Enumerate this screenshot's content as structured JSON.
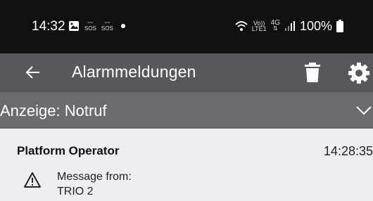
{
  "status_bar": {
    "time": "14:32",
    "sos_1": "SOS",
    "sos_2": "SOS",
    "volte_top": "Vo))",
    "volte_bottom": "LTE1",
    "network": "4G",
    "battery": "100%"
  },
  "app_bar": {
    "title": "Alarmmeldungen"
  },
  "filter": {
    "label": "Anzeige: Notruf"
  },
  "message": {
    "sender": "Platform Operator",
    "time": "14:28:35",
    "line1": "Message from:",
    "line2": "TRIO 2"
  },
  "colors": {
    "status_bar": "#111111",
    "app_bar": "#56585e",
    "filter_bar": "#696b71",
    "content_bg": "#ecedf2"
  }
}
